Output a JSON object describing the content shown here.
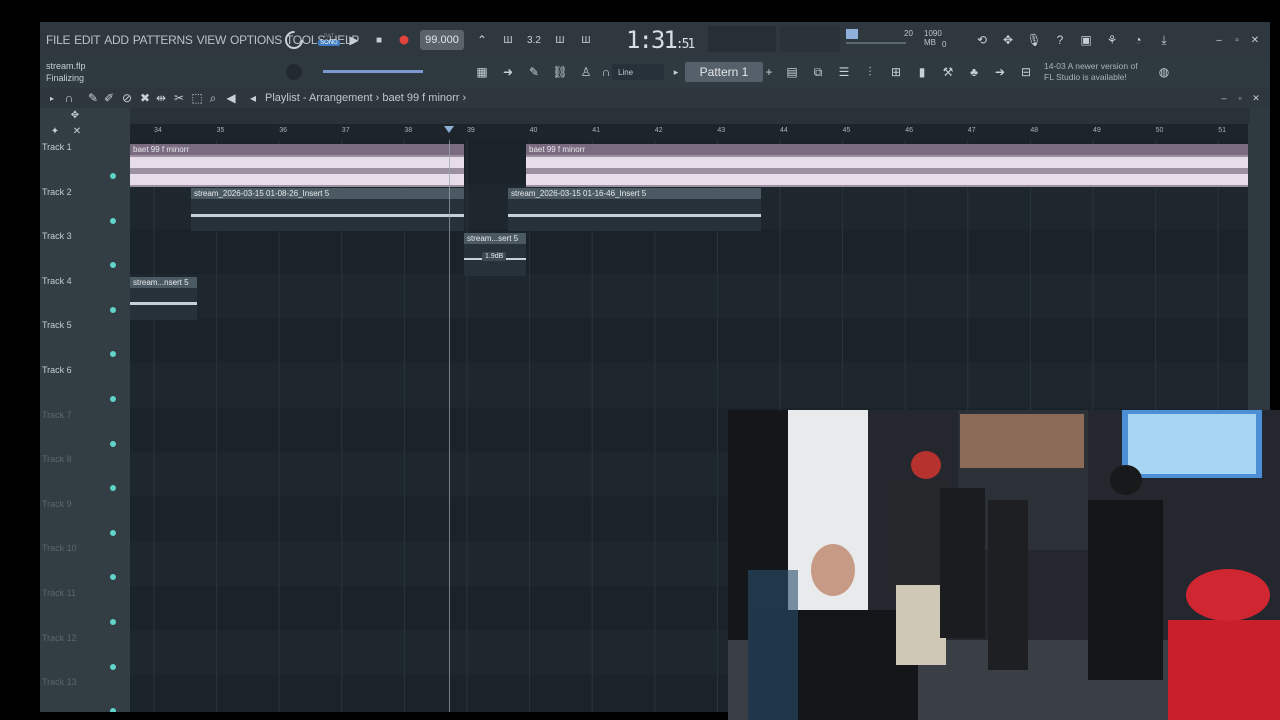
{
  "menu": [
    "FILE",
    "EDIT",
    "ADD",
    "PATTERNS",
    "VIEW",
    "OPTIONS",
    "TOOLS",
    "HELP"
  ],
  "hint": {
    "file": "stream.flp",
    "status": "Finalizing"
  },
  "transport": {
    "mode_pat": "PAT",
    "mode_song": "SONG",
    "tempo": "99.000",
    "time_main": "1:31",
    "time_small": ":51"
  },
  "cpu": {
    "value": "20",
    "memory": "1090 MB",
    "voices": "0"
  },
  "snap": "Line",
  "pattern": "Pattern 1",
  "notice": {
    "date": "14-03",
    "text_a": "A newer version of",
    "text_b": "FL Studio is available!"
  },
  "playlist": {
    "breadcrumb": "Playlist - Arrangement",
    "sep": "›",
    "pattern_name": "baet 99 f minorr"
  },
  "ruler": [
    "34",
    "35",
    "36",
    "37",
    "38",
    "39",
    "40",
    "41",
    "42",
    "43",
    "44",
    "45",
    "46",
    "47",
    "48",
    "49",
    "50",
    "51"
  ],
  "tracks": [
    "Track 1",
    "Track 2",
    "Track 3",
    "Track 4",
    "Track 5",
    "Track 6",
    "Track 7",
    "Track 8",
    "Track 9",
    "Track 10",
    "Track 11",
    "Track 12",
    "Track 13"
  ],
  "clips": {
    "c1": "baet 99 f minorr",
    "c2": "baet 99 f minorr",
    "c3": "stream_2026-03-15 01-08-26_Insert 5",
    "c4": "stream_2026-03-15 01-16-46_Insert 5",
    "c5": "stream...sert 5",
    "c5_vol": "1.9dB",
    "c6": "stream...nsert 5"
  },
  "colors": {
    "accent": "#5fd3c8",
    "record": "#e0443a",
    "clip_pink": "#d8c8d8"
  }
}
